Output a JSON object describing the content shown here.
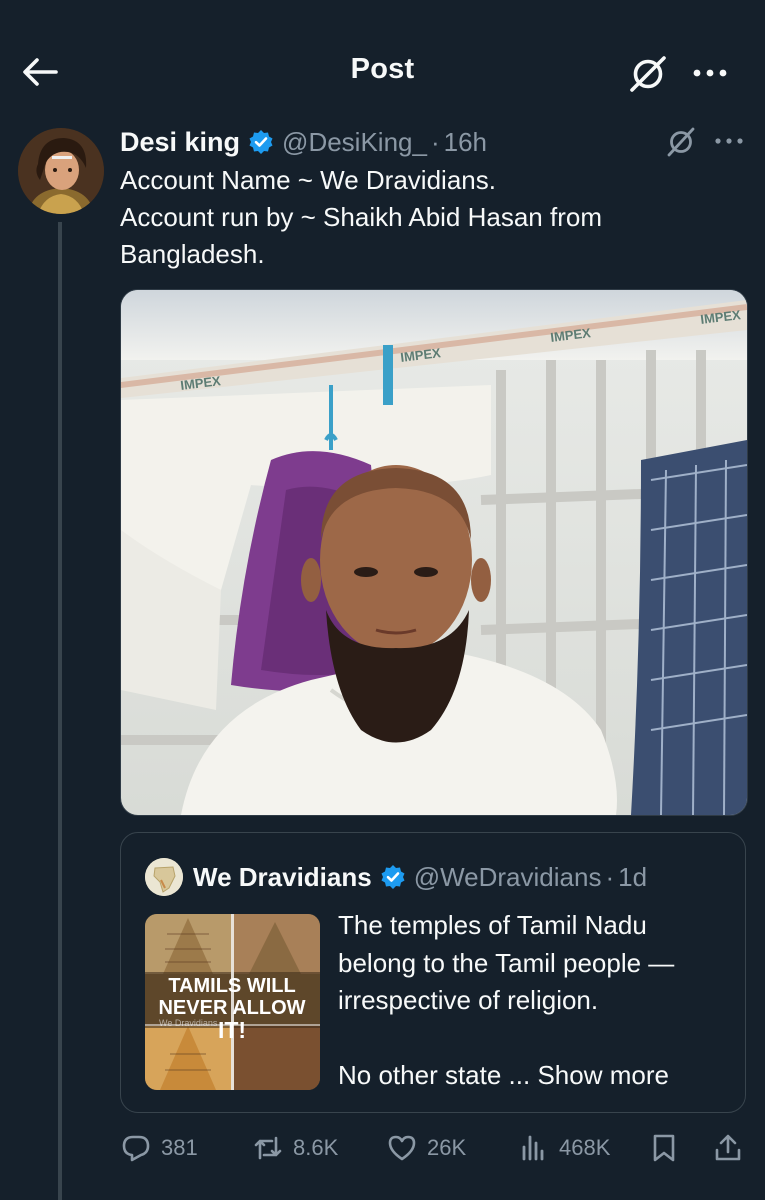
{
  "header": {
    "title": "Post",
    "back_icon": "arrow-left-icon",
    "grok_icon": "grok-icon",
    "more_icon": "more-horizontal-icon"
  },
  "post": {
    "author_name": "Desi king",
    "handle": "@DesiKing_",
    "separator": "·",
    "time": "16h",
    "text_lines": [
      "Account Name ~ We Dravidians.",
      "Account run by ~ Shaikh Abid Hasan from",
      "Bangladesh."
    ],
    "media_alt": "Photo of a bearded man in a white shirt standing in front of barred windows and hanging clothes",
    "media_banner_text": "IMPEX"
  },
  "quote": {
    "author_name": "We Dravidians",
    "handle": "@WeDravidians",
    "separator": "·",
    "time": "1d",
    "thumb_text_1": "TAMILS WILL",
    "thumb_text_2": "NEVER ALLOW",
    "thumb_text_3": "IT!",
    "thumb_watermark": "We Dravidians",
    "text_lines": [
      "The temples of Tamil Nadu",
      "belong to the Tamil people —",
      "irrespective of religion."
    ],
    "text_last_prefix": "No other state ...",
    "show_more": "Show more"
  },
  "actions": {
    "replies": "381",
    "reposts": "8.6K",
    "likes": "26K",
    "views": "468K"
  },
  "colors": {
    "background": "#15202b",
    "text": "#f7f9f9",
    "muted": "#8b98a5",
    "verified": "#1d9bf0",
    "border": "#38444d"
  }
}
